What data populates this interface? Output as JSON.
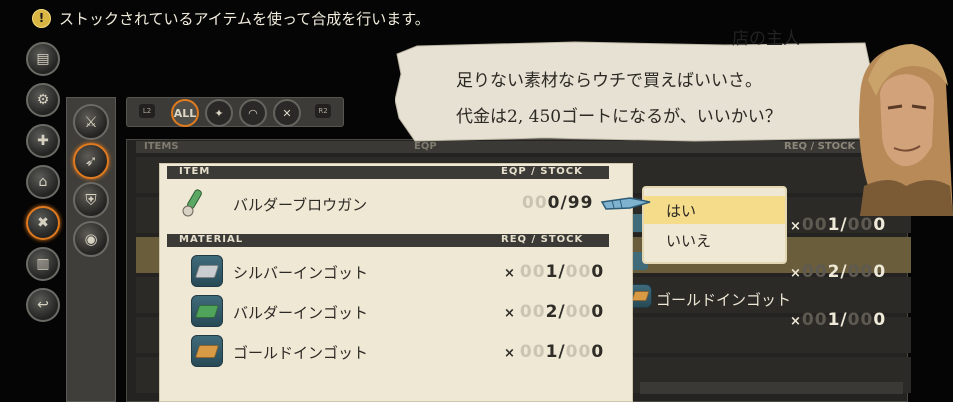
{
  "hint": {
    "text": "ストックされているアイテムを使って合成を行います。"
  },
  "filters": {
    "left_tag": "L2",
    "right_tag": "R2",
    "all_label": "ALL"
  },
  "background_list": {
    "col_items": "ITEMS",
    "col_eqp": "EQP",
    "right_header_req": "REQ / STOCK",
    "right_rows": [
      {
        "name": "",
        "count": "1",
        "stock": "0"
      },
      {
        "name": "",
        "count": "2",
        "stock": "0"
      },
      {
        "name": "ゴールドインゴット",
        "count": "1",
        "stock": "0"
      }
    ]
  },
  "dialog": {
    "item_header": "ITEM",
    "item_col": "EQP / STOCK",
    "item": {
      "name": "バルダーブロウガン",
      "eqp": "0",
      "stock": "99"
    },
    "material_header": "MATERIAL",
    "material_col": "REQ / STOCK",
    "materials": [
      {
        "name": "シルバーインゴット",
        "req": "1",
        "stock": "0",
        "color": "#c9cdd0"
      },
      {
        "name": "バルダーインゴット",
        "req": "2",
        "stock": "0",
        "color": "#4fa35a"
      },
      {
        "name": "ゴールドインゴット",
        "req": "1",
        "stock": "0",
        "color": "#d89a45"
      }
    ]
  },
  "speech": {
    "speaker": "店の主人",
    "line1": "足りない素材ならウチで買えばいいさ。",
    "line2": "代金は2, 450ゴートになるが、いいかい？"
  },
  "choices": {
    "yes": "はい",
    "no": "いいえ",
    "selected": "yes"
  },
  "icons": {
    "nav": [
      "treasure-chest-icon",
      "gear-bag-icon",
      "heal-icon",
      "camp-icon",
      "synthesis-icon",
      "stock-icon",
      "return-icon"
    ],
    "categories": [
      "sword-icon",
      "bow-icon",
      "armor-icon",
      "accessory-icon"
    ],
    "filters": [
      "all-icon",
      "dagger-icon",
      "bow-filter-icon",
      "crossbow-icon"
    ]
  },
  "colors": {
    "accent": "#e07a1f",
    "parchment": "#efe8d5",
    "selection": "#f5dc8b"
  }
}
